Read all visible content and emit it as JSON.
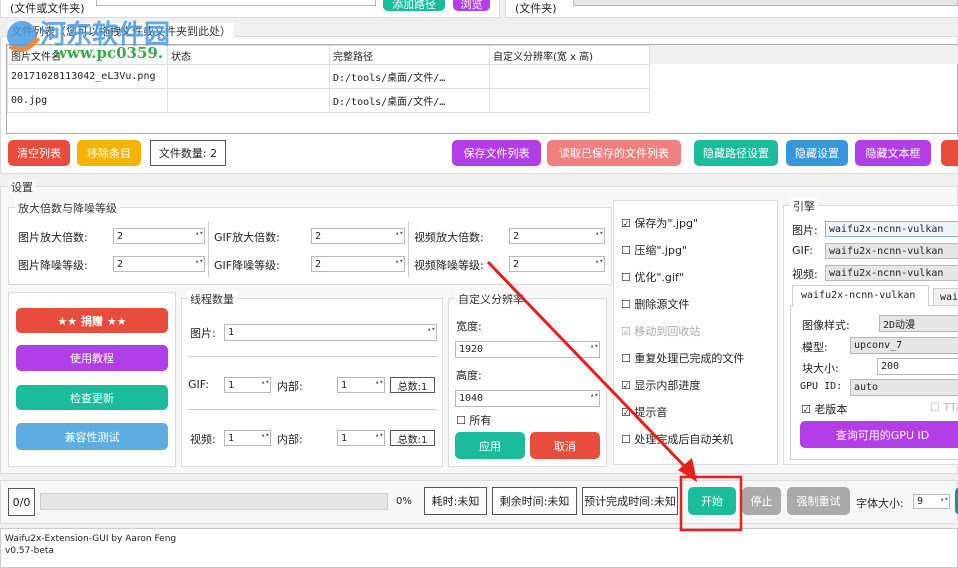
{
  "top": {
    "input_label": "(文件或文件夹)",
    "add_path": "添加路径",
    "browse": "浏览",
    "output_label": "(文件夹)"
  },
  "file_list": {
    "title": "文件列表（您可以拖拽文件或文件夹到此处）",
    "columns": [
      "图片文件名",
      "状态",
      "完整路径",
      "自定义分辨率(宽 x 高)"
    ],
    "rows": [
      [
        "20171028113042_eL3Vu.png",
        "",
        "D:/tools/桌面/文件/…",
        ""
      ],
      [
        "00.jpg",
        "",
        "D:/tools/桌面/文件/…",
        ""
      ]
    ]
  },
  "list_buttons": {
    "clear": "清空列表",
    "remove": "移除条目",
    "count": "文件数量: 2",
    "save": "保存文件列表",
    "load": "读取已保存的文件列表",
    "hide_path": "隐藏路径设置",
    "hide_settings": "隐藏设置",
    "hide_text": "隐藏文本框"
  },
  "settings": {
    "title": "设置",
    "scale": {
      "title": "放大倍数与降噪等级",
      "img_scale": "图片放大倍数:",
      "img_scale_v": "2",
      "img_noise": "图片降噪等级:",
      "img_noise_v": "2",
      "gif_scale": "GIF放大倍数:",
      "gif_scale_v": "2",
      "gif_noise": "GIF降噪等级:",
      "gif_noise_v": "2",
      "vid_scale": "视频放大倍数:",
      "vid_scale_v": "2",
      "vid_noise": "视频降噪等级:",
      "vid_noise_v": "2"
    },
    "left_buttons": {
      "donate": "★★ 捐赠 ★★",
      "tutorial": "使用教程",
      "update": "检查更新",
      "compat": "兼容性测试"
    },
    "threads": {
      "title": "线程数量",
      "img": "图片:",
      "img_v": "1",
      "gif": "GIF:",
      "gif_v": "1",
      "inner": "内部:",
      "gif_inner_v": "1",
      "total_gif": "总数:1",
      "vid": "视频:",
      "vid_v": "1",
      "vid_inner_v": "1",
      "total_vid": "总数:1"
    },
    "custom_res": {
      "title": "自定义分辨率",
      "width": "宽度:",
      "width_v": "1920",
      "height": "高度:",
      "height_v": "1040",
      "all": "所有",
      "apply": "应用",
      "cancel": "取消"
    },
    "options": [
      {
        "label": "保存为\".jpg\"",
        "checked": true
      },
      {
        "label": "压缩\".jpg\"",
        "checked": false
      },
      {
        "label": "优化\".gif\"",
        "checked": false
      },
      {
        "label": "删除源文件",
        "checked": false
      },
      {
        "label": "移动到回收站",
        "checked": true,
        "disabled": true
      },
      {
        "label": "重复处理已完成的文件",
        "checked": false
      },
      {
        "label": "显示内部进度",
        "checked": true
      },
      {
        "label": "提示音",
        "checked": true
      },
      {
        "label": "处理完成后自动关机",
        "checked": false
      }
    ],
    "engine": {
      "title": "引擎",
      "img": "图片:",
      "img_v": "waifu2x-ncnn-vulkan",
      "gif": "GIF:",
      "gif_v": "waifu2x-ncnn-vulkan",
      "vid": "视频:",
      "vid_v": "waifu2x-ncnn-vulkan",
      "tab1": "waifu2x-ncnn-vulkan",
      "tab2": "wai",
      "style": "图像样式:",
      "style_v": "2D动漫",
      "model": "模型:",
      "model_v": "upconv_7",
      "tile": "块大小:",
      "tile_v": "200",
      "gpu": "GPU ID:",
      "gpu_v": "auto",
      "old": "老版本",
      "tta": "TTA",
      "query": "查询可用的GPU ID"
    }
  },
  "bottom": {
    "count": "0/0",
    "progress_percent": 0,
    "percent": "0%",
    "elapsed": "耗时:未知",
    "remaining": "剩余时间:未知",
    "eta": "预计完成时间:未知",
    "start": "开始",
    "stop": "停止",
    "retry": "强制重试",
    "font_size": "字体大小:",
    "font_size_v": "9"
  },
  "log": [
    "Waifu2x-Extension-GUI by Aaron Feng",
    "v0.57-beta"
  ],
  "watermark": {
    "name": "河东软件园",
    "url": "www.pc0359."
  },
  "colors": {
    "red": "#e74c3c",
    "yellow": "#f5b400",
    "purple": "#b23ee8",
    "pink": "#f08080",
    "green": "#1abc9c",
    "blue": "#3498db",
    "lightblue": "#5dade2",
    "gray": "#aaaaaa"
  }
}
